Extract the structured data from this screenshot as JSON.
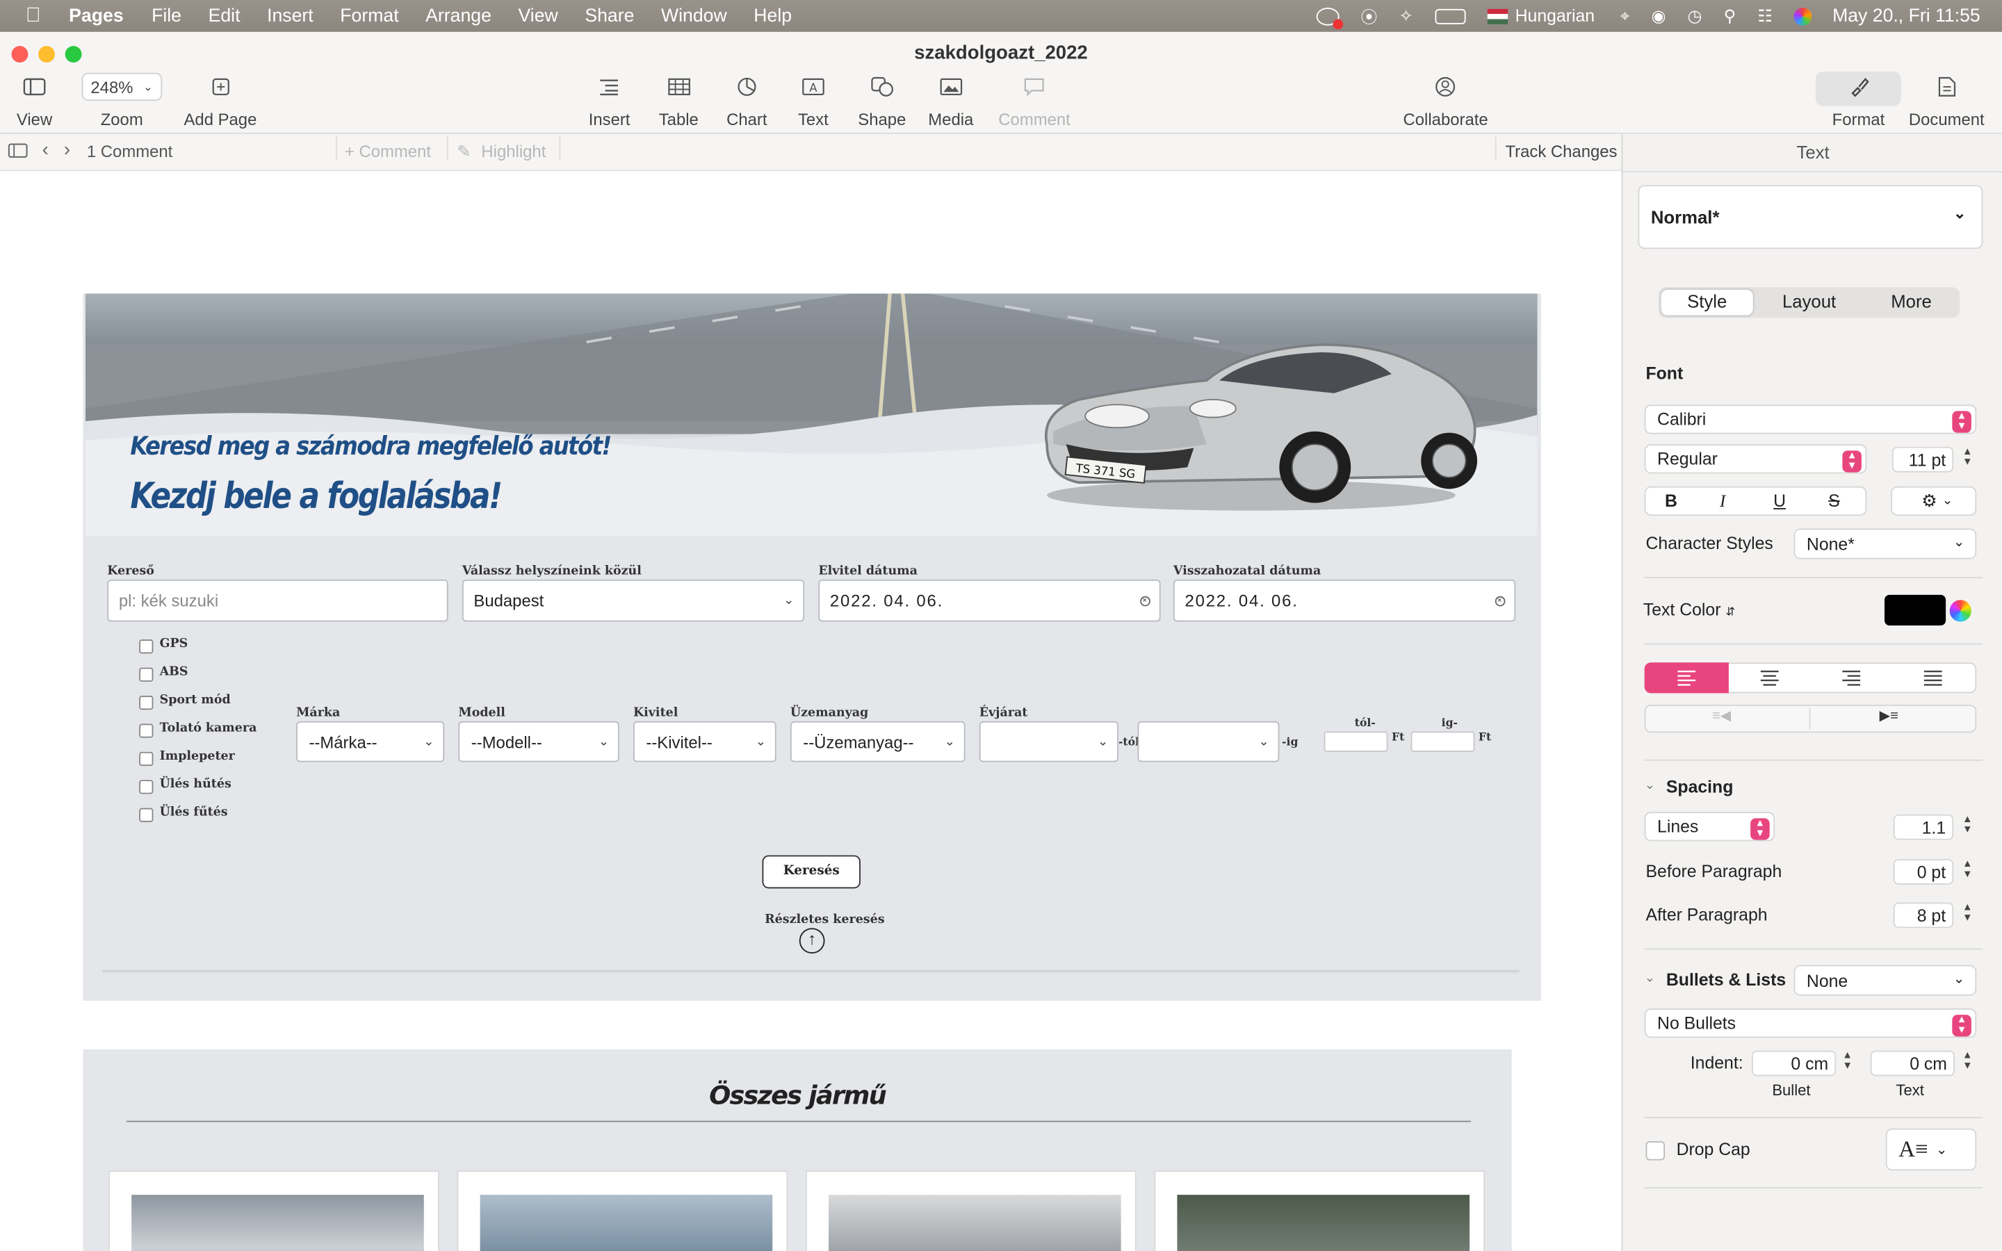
{
  "menubar": {
    "app": "Pages",
    "items": [
      "File",
      "Edit",
      "Insert",
      "Format",
      "Arrange",
      "View",
      "Share",
      "Window",
      "Help"
    ],
    "keyboard": "Hungarian",
    "datetime": "May 20., Fri  11:55"
  },
  "window": {
    "title": "szakdolgoazt_2022",
    "toolbar": {
      "view": "View",
      "zoom_value": "248%",
      "zoom": "Zoom",
      "add_page": "Add Page",
      "insert": "Insert",
      "table": "Table",
      "chart": "Chart",
      "text": "Text",
      "shape": "Shape",
      "media": "Media",
      "comment": "Comment",
      "collaborate": "Collaborate",
      "format": "Format",
      "document": "Document"
    },
    "commentbar": {
      "count": "1 Comment",
      "comment": "+ Comment",
      "highlight": "Highlight",
      "track": "Track Changes"
    }
  },
  "page": {
    "headline1": "Keresd meg a számodra megfelelő autót!",
    "headline2": "Kezdj bele a foglalásba!",
    "plate": "TS 371 SG",
    "search": {
      "label": "Kereső",
      "placeholder": "pl: kék suzuki"
    },
    "location": {
      "label": "Válassz helyszíneink közül",
      "value": "Budapest"
    },
    "pickup": {
      "label": "Elvitel dátuma",
      "value": "2022. 04. 06."
    },
    "return": {
      "label": "Visszahozatal dátuma",
      "value": "2022. 04. 06."
    },
    "features": [
      "GPS",
      "ABS",
      "Sport mód",
      "Tolató kamera",
      "Implepeter",
      "Ülés hűtés",
      "Ülés fűtés"
    ],
    "filters": {
      "brand": {
        "label": "Márka",
        "value": "--Márka--"
      },
      "model": {
        "label": "Modell",
        "value": "--Modell--"
      },
      "body": {
        "label": "Kivitel",
        "value": "--Kivitel--"
      },
      "fuel": {
        "label": "Üzemanyag",
        "value": "--Üzemanyag--"
      },
      "year": {
        "label": "Évjárat",
        "from_suffix": "-tól",
        "to_suffix": "-ig"
      },
      "price_from": "tól-",
      "price_to": "ig-",
      "currency": "Ft"
    },
    "search_button": "Keresés",
    "detailed": "Részletes keresés",
    "all_vehicles": "Összes jármű"
  },
  "inspector": {
    "tab": "Text",
    "para_style": "Normal*",
    "segments": [
      "Style",
      "Layout",
      "More"
    ],
    "font_label": "Font",
    "font": "Calibri",
    "weight": "Regular",
    "size": "11 pt",
    "char_styles_label": "Character Styles",
    "char_styles": "None*",
    "text_color_label": "Text Color",
    "text_color": "#000000",
    "accent": "#e8457e",
    "spacing_label": "Spacing",
    "spacing_mode": "Lines",
    "spacing_value": "1.1",
    "before_label": "Before Paragraph",
    "before_value": "0 pt",
    "after_label": "After Paragraph",
    "after_value": "8 pt",
    "bullets_label": "Bullets & Lists",
    "bullets_value": "None",
    "bullets_style": "No Bullets",
    "indent_label": "Indent:",
    "indent_bullet": "0 cm",
    "indent_text": "0 cm",
    "bullet_caption": "Bullet",
    "text_caption": "Text",
    "drop_cap": "Drop Cap"
  }
}
